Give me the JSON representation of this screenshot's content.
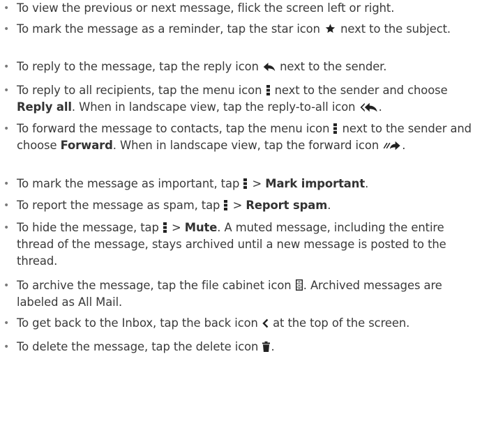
{
  "items": [
    {
      "text": "To view the previous or next message, flick the screen left or right."
    },
    {
      "a": "To mark the message as a reminder, tap the star icon ",
      "icon": "star-icon",
      "b": " next to the subject."
    },
    {
      "a": "To reply to the message, tap the reply icon ",
      "icon": "reply-icon",
      "b": " next to the sender."
    },
    {
      "a": "To reply to all recipients, tap the menu icon ",
      "icon1": "menu-icon",
      "b": " next to the sender and choose ",
      "bold1": "Reply all",
      "c": ". When in landscape view, tap the reply-to-all icon ",
      "icon2": "reply-all-icon",
      "d": "."
    },
    {
      "a": "To forward the message to contacts, tap the menu icon ",
      "icon1": "menu-icon",
      "b": " next to the sender and choose ",
      "bold1": "Forward",
      "c": ". When in landscape view, tap the forward icon ",
      "icon2": "forward-icon",
      "d": "."
    },
    {
      "a": "To mark the message as important, tap ",
      "icon": "menu-icon",
      "b": " > ",
      "bold1": "Mark important",
      "c": "."
    },
    {
      "a": "To report the message as spam, tap ",
      "icon": "menu-icon",
      "b": " > ",
      "bold1": "Report spam",
      "c": "."
    },
    {
      "a": "To hide the message, tap ",
      "icon": "menu-icon",
      "b": " > ",
      "bold1": "Mute",
      "c": ". A muted message, including the entire thread of the message, stays archived until a new message is posted to the thread."
    },
    {
      "a": "To archive the message, tap the file cabinet icon ",
      "icon": "file-cabinet-icon",
      "b": ". Archived messages are labeled as All Mail."
    },
    {
      "a": "To get back to the Inbox, tap the back icon ",
      "icon": "back-icon",
      "b": " at the top of the screen."
    },
    {
      "a": "To delete the message, tap the delete icon ",
      "icon": "delete-icon",
      "b": "."
    }
  ]
}
